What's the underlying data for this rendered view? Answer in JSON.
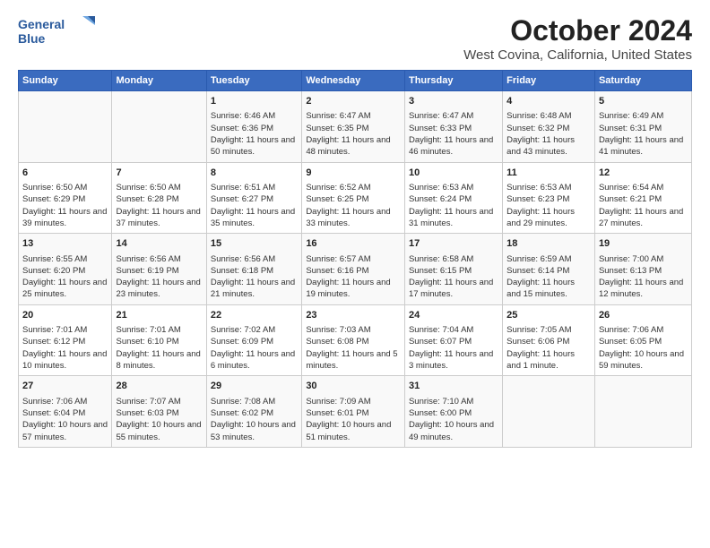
{
  "header": {
    "logo_line1": "General",
    "logo_line2": "Blue",
    "title": "October 2024",
    "subtitle": "West Covina, California, United States"
  },
  "columns": [
    "Sunday",
    "Monday",
    "Tuesday",
    "Wednesday",
    "Thursday",
    "Friday",
    "Saturday"
  ],
  "weeks": [
    [
      {
        "day": "",
        "info": ""
      },
      {
        "day": "",
        "info": ""
      },
      {
        "day": "1",
        "info": "Sunrise: 6:46 AM\nSunset: 6:36 PM\nDaylight: 11 hours and 50 minutes."
      },
      {
        "day": "2",
        "info": "Sunrise: 6:47 AM\nSunset: 6:35 PM\nDaylight: 11 hours and 48 minutes."
      },
      {
        "day": "3",
        "info": "Sunrise: 6:47 AM\nSunset: 6:33 PM\nDaylight: 11 hours and 46 minutes."
      },
      {
        "day": "4",
        "info": "Sunrise: 6:48 AM\nSunset: 6:32 PM\nDaylight: 11 hours and 43 minutes."
      },
      {
        "day": "5",
        "info": "Sunrise: 6:49 AM\nSunset: 6:31 PM\nDaylight: 11 hours and 41 minutes."
      }
    ],
    [
      {
        "day": "6",
        "info": "Sunrise: 6:50 AM\nSunset: 6:29 PM\nDaylight: 11 hours and 39 minutes."
      },
      {
        "day": "7",
        "info": "Sunrise: 6:50 AM\nSunset: 6:28 PM\nDaylight: 11 hours and 37 minutes."
      },
      {
        "day": "8",
        "info": "Sunrise: 6:51 AM\nSunset: 6:27 PM\nDaylight: 11 hours and 35 minutes."
      },
      {
        "day": "9",
        "info": "Sunrise: 6:52 AM\nSunset: 6:25 PM\nDaylight: 11 hours and 33 minutes."
      },
      {
        "day": "10",
        "info": "Sunrise: 6:53 AM\nSunset: 6:24 PM\nDaylight: 11 hours and 31 minutes."
      },
      {
        "day": "11",
        "info": "Sunrise: 6:53 AM\nSunset: 6:23 PM\nDaylight: 11 hours and 29 minutes."
      },
      {
        "day": "12",
        "info": "Sunrise: 6:54 AM\nSunset: 6:21 PM\nDaylight: 11 hours and 27 minutes."
      }
    ],
    [
      {
        "day": "13",
        "info": "Sunrise: 6:55 AM\nSunset: 6:20 PM\nDaylight: 11 hours and 25 minutes."
      },
      {
        "day": "14",
        "info": "Sunrise: 6:56 AM\nSunset: 6:19 PM\nDaylight: 11 hours and 23 minutes."
      },
      {
        "day": "15",
        "info": "Sunrise: 6:56 AM\nSunset: 6:18 PM\nDaylight: 11 hours and 21 minutes."
      },
      {
        "day": "16",
        "info": "Sunrise: 6:57 AM\nSunset: 6:16 PM\nDaylight: 11 hours and 19 minutes."
      },
      {
        "day": "17",
        "info": "Sunrise: 6:58 AM\nSunset: 6:15 PM\nDaylight: 11 hours and 17 minutes."
      },
      {
        "day": "18",
        "info": "Sunrise: 6:59 AM\nSunset: 6:14 PM\nDaylight: 11 hours and 15 minutes."
      },
      {
        "day": "19",
        "info": "Sunrise: 7:00 AM\nSunset: 6:13 PM\nDaylight: 11 hours and 12 minutes."
      }
    ],
    [
      {
        "day": "20",
        "info": "Sunrise: 7:01 AM\nSunset: 6:12 PM\nDaylight: 11 hours and 10 minutes."
      },
      {
        "day": "21",
        "info": "Sunrise: 7:01 AM\nSunset: 6:10 PM\nDaylight: 11 hours and 8 minutes."
      },
      {
        "day": "22",
        "info": "Sunrise: 7:02 AM\nSunset: 6:09 PM\nDaylight: 11 hours and 6 minutes."
      },
      {
        "day": "23",
        "info": "Sunrise: 7:03 AM\nSunset: 6:08 PM\nDaylight: 11 hours and 5 minutes."
      },
      {
        "day": "24",
        "info": "Sunrise: 7:04 AM\nSunset: 6:07 PM\nDaylight: 11 hours and 3 minutes."
      },
      {
        "day": "25",
        "info": "Sunrise: 7:05 AM\nSunset: 6:06 PM\nDaylight: 11 hours and 1 minute."
      },
      {
        "day": "26",
        "info": "Sunrise: 7:06 AM\nSunset: 6:05 PM\nDaylight: 10 hours and 59 minutes."
      }
    ],
    [
      {
        "day": "27",
        "info": "Sunrise: 7:06 AM\nSunset: 6:04 PM\nDaylight: 10 hours and 57 minutes."
      },
      {
        "day": "28",
        "info": "Sunrise: 7:07 AM\nSunset: 6:03 PM\nDaylight: 10 hours and 55 minutes."
      },
      {
        "day": "29",
        "info": "Sunrise: 7:08 AM\nSunset: 6:02 PM\nDaylight: 10 hours and 53 minutes."
      },
      {
        "day": "30",
        "info": "Sunrise: 7:09 AM\nSunset: 6:01 PM\nDaylight: 10 hours and 51 minutes."
      },
      {
        "day": "31",
        "info": "Sunrise: 7:10 AM\nSunset: 6:00 PM\nDaylight: 10 hours and 49 minutes."
      },
      {
        "day": "",
        "info": ""
      },
      {
        "day": "",
        "info": ""
      }
    ]
  ]
}
